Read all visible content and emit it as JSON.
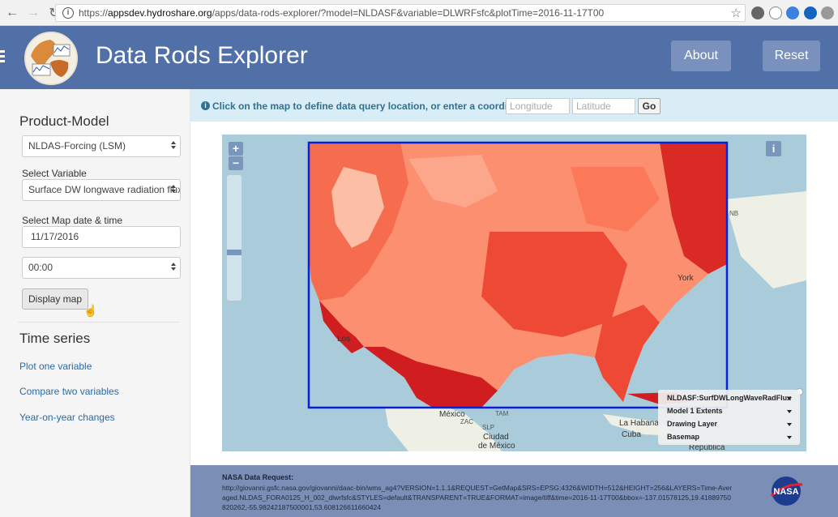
{
  "browser": {
    "url_prefix": "https://",
    "url_host": "appsdev.hydroshare.org",
    "url_path": "/apps/data-rods-explorer/?model=NLDASF&variable=DLWRFsfc&plotTime=2016-11-17T00"
  },
  "header": {
    "title": "Data Rods Explorer",
    "about_label": "About",
    "reset_label": "Reset"
  },
  "sidebar": {
    "product_heading": "Product-Model",
    "model_value": "NLDAS-Forcing (LSM)",
    "variable_label": "Select Variable",
    "variable_value": "Surface DW longwave radiation flux",
    "date_label": "Select Map date & time",
    "date_value": "11/17/2016",
    "time_value": "00:00",
    "display_button": "Display map",
    "timeseries_heading": "Time series",
    "links": [
      "Plot one variable",
      "Compare two variables",
      "Year-on-year changes"
    ]
  },
  "infobar": {
    "message": "Click on the map to define data query location, or enter a coordinate:",
    "lon_placeholder": "Longitude",
    "lat_placeholder": "Latitude",
    "go_label": "Go"
  },
  "map": {
    "zoom_in": "+",
    "zoom_out": "−",
    "info_label": "i",
    "zoom_level": 0.62,
    "place_labels": [
      "York",
      "Los",
      "México",
      "Ciudad",
      "de México",
      "La Habana",
      "Cuba",
      "República",
      "NB",
      "ZAC",
      "SLP",
      "TAM"
    ],
    "layers": [
      "NLDASF:SurfDWLongWaveRadFlux",
      "Model 1 Extents",
      "Drawing Layer",
      "Basemap"
    ],
    "colors": {
      "extent": "#0a1fd6",
      "high": "#cf1d20",
      "mid": "#ee4935",
      "low": "#fb8f70",
      "water": "#aacbd9"
    }
  },
  "footer": {
    "title": "NASA Data Request:",
    "request_url": "http://giovanni.gsfc.nasa.gov/giovanni/daac-bin/wms_ag4?VERSION=1.1.1&REQUEST=GetMap&SRS=EPSG:4326&WIDTH=512&HEIGHT=256&LAYERS=Time-Averaged.NLDAS_FORA0125_H_002_dlwrfsfc&STYLES=default&TRANSPARENT=TRUE&FORMAT=image/tiff&time=2016-11-17T00&bbox=-137.01578125,19.41889750820262,-55.98242187500001,53.608126611660424",
    "logo_text": "NASA"
  }
}
